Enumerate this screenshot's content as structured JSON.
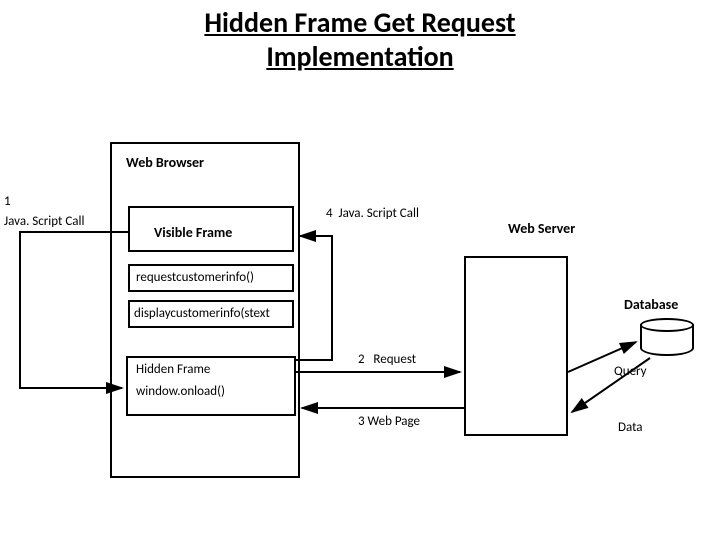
{
  "title": "Hidden Frame Get Request\nImplementation",
  "labels": {
    "web_browser": "Web Browser",
    "step1_num": "1",
    "step1_text": "Java. Script Call",
    "visible_frame": "Visible Frame",
    "func_request": "requestcustomerinfo()",
    "func_display": "displaycustomerinfo(stext",
    "hidden_frame": "Hidden Frame",
    "window_onload": "window.onload()",
    "step4": "4  Java. Script Call",
    "web_server": "Web Server",
    "database": "Database",
    "step2": "2   Request",
    "step3": "3 Web Page",
    "query": "Query",
    "data": "Data"
  }
}
